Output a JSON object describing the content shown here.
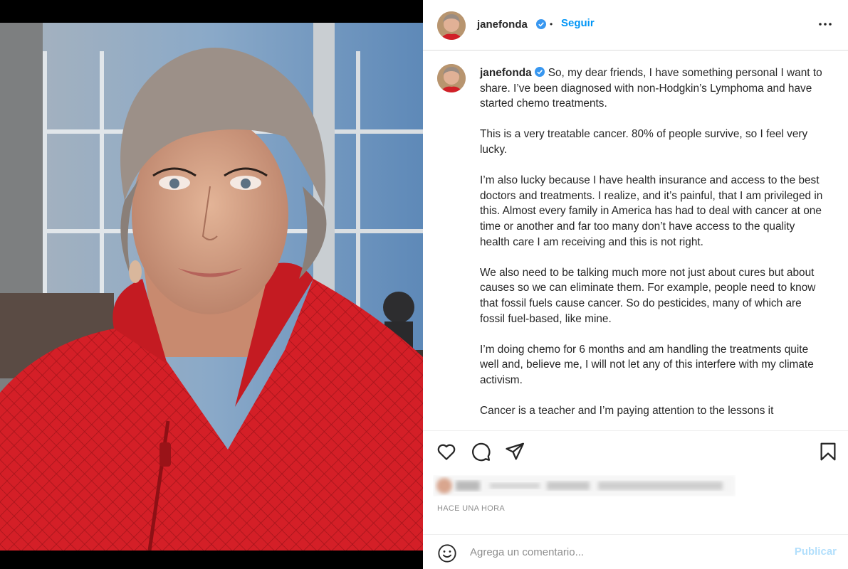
{
  "header": {
    "username": "janefonda",
    "separator": "•",
    "follow_label": "Seguir",
    "more_icon": "more-horizontal-icon"
  },
  "caption": {
    "username": "janefonda",
    "paragraphs": [
      "So, my dear friends, I have something personal I want to share. I’ve been diagnosed with non-Hodgkin’s Lymphoma and have started chemo treatments.",
      "This is a very treatable cancer. 80% of people survive, so I feel very lucky.",
      "I’m also lucky because I have health insurance and access to the best doctors and treatments. I realize, and it’s painful, that I am privileged in this. Almost every family in America has had to deal with cancer at one time or another and far too many don’t have access to the quality health care I am receiving and this is not right.",
      "We also need to be talking much more not just about cures but about causes so we can eliminate them. For example, people need to know that fossil fuels cause cancer. So do pesticides, many of which are fossil fuel-based, like mine.",
      "I’m doing chemo for 6 months and am handling the treatments quite well and, believe me, I will not let any of this interfere with my climate activism.",
      "Cancer is a teacher and I’m paying attention to the lessons it"
    ]
  },
  "actions": {
    "like_icon": "heart-icon",
    "comment_icon": "comment-icon",
    "share_icon": "send-icon",
    "save_icon": "bookmark-icon"
  },
  "timestamp": "HACE UNA HORA",
  "comment": {
    "emoji_icon": "emoji-icon",
    "placeholder": "Agrega un comentario...",
    "publish_label": "Publicar"
  },
  "colors": {
    "accent": "#0095f6",
    "verified": "#3897f0",
    "publish_disabled": "#b2dffc",
    "jacket": "#d81f26"
  }
}
